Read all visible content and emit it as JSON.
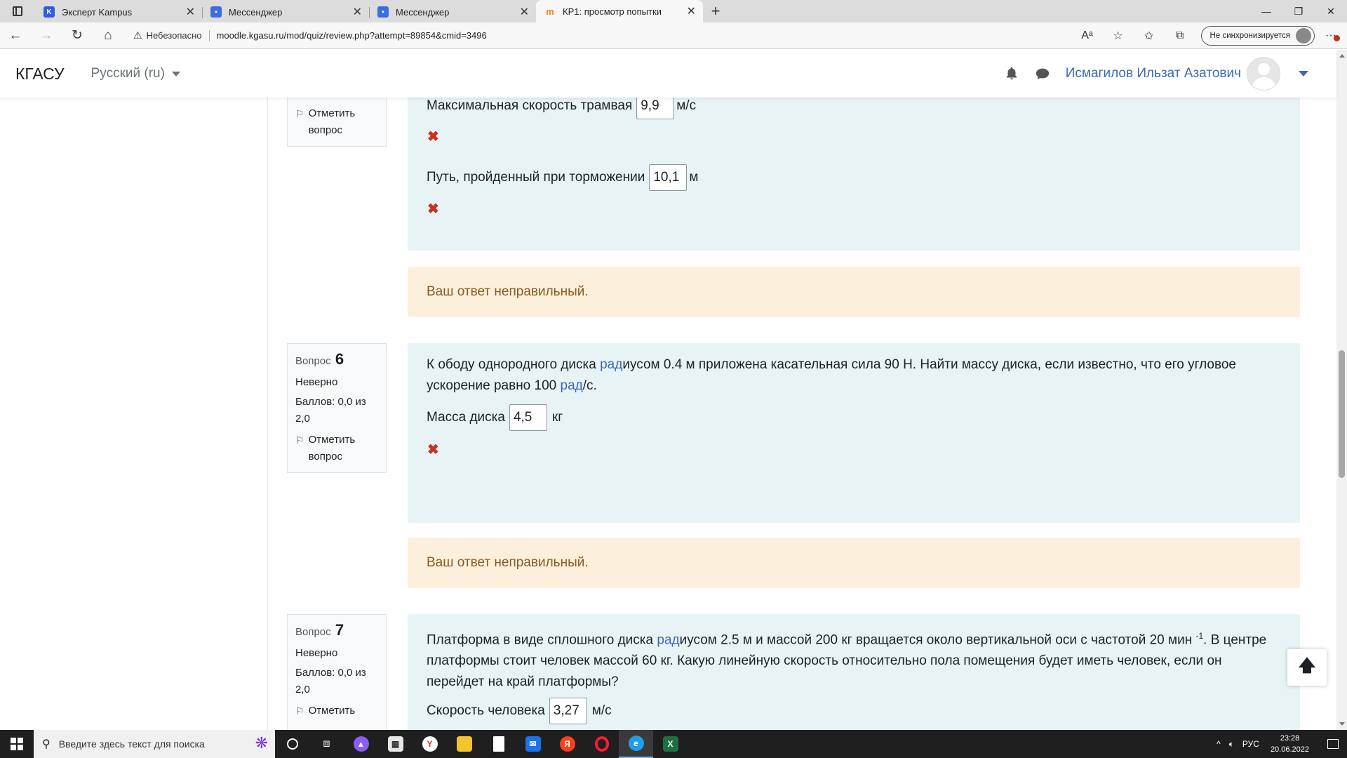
{
  "browser": {
    "tabs": [
      {
        "title": "Эксперт Kampus",
        "icon": "kampus-icon",
        "active": false
      },
      {
        "title": "Мессенджер",
        "icon": "messenger-icon",
        "active": false
      },
      {
        "title": "Мессенджер",
        "icon": "messenger-icon",
        "active": false
      },
      {
        "title": "КР1: просмотр попытки",
        "icon": "moodle-icon",
        "active": true
      }
    ],
    "insecure_label": "Небезопасно",
    "url": "moodle.kgasu.ru/mod/quiz/review.php?attempt=89854&cmid=3496",
    "sync_label": "Не синхронизируется"
  },
  "navbar": {
    "brand": "КГАСУ",
    "language": "Русский (ru)",
    "user_name": "Исмагилов Ильзат Азатович"
  },
  "q5_tail": {
    "flag_label": "Отметить вопрос",
    "answers": [
      {
        "label": "Максимальная скорость трамвая",
        "value": "9,9",
        "unit": "м/с"
      },
      {
        "label": "Путь, пройденный при торможении",
        "value": "10,1",
        "unit": "м"
      }
    ],
    "feedback": "Ваш ответ неправильный."
  },
  "q6": {
    "prefix": "Вопрос",
    "number": "6",
    "state": "Неверно",
    "grade": "Баллов: 0,0 из 2,0",
    "flag_label": "Отметить вопрос",
    "text_a": "К ободу однородного диска ",
    "link_a": "рад",
    "text_b": "иусом 0.4 м приложена касательная сила 90 Н. Найти массу диска, если известно, что его угловое ускорение равно 100 ",
    "link_b": "рад",
    "text_c": "/с.",
    "answer_label": "Масса диска",
    "answer_value": "4,5",
    "answer_unit": "кг",
    "feedback": "Ваш ответ неправильный."
  },
  "q7": {
    "prefix": "Вопрос",
    "number": "7",
    "state": "Неверно",
    "grade": "Баллов: 0,0 из 2,0",
    "flag_label": "Отметить",
    "text_a": "Платформа в виде сплошного диска ",
    "link_a": "рад",
    "text_b": "иусом 2.5 м и массой 200 кг вращается около вертикальной оси с частотой 20 мин ",
    "sup": "-1",
    "text_c": ". В центре платформы стоит человек массой 60 кг. Какую линейную скорость относительно пола помещения будет иметь человек, если он перейдет на край платформы?",
    "answer_label": "Скорость человека",
    "answer_value": "3,27",
    "answer_unit": "м/с"
  },
  "taskbar": {
    "search_placeholder": "Введите здесь текст для поиска",
    "lang": "РУС",
    "time": "23:28",
    "date": "20.06.2022"
  },
  "colors": {
    "accent_link": "#3a6bb3",
    "formulation_bg": "#e7f3f5",
    "feedback_bg": "#fcefdc",
    "incorrect_mark": "#ca3120"
  }
}
